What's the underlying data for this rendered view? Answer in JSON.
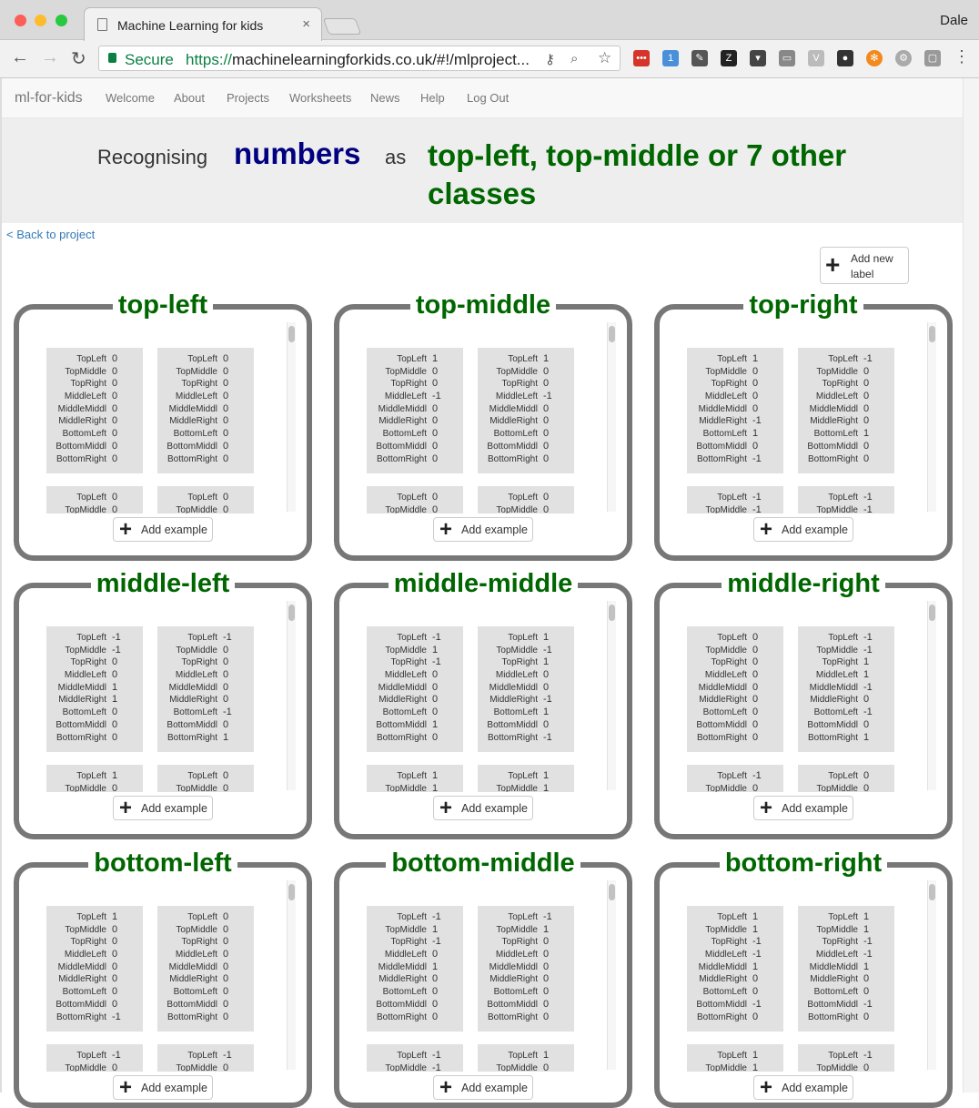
{
  "browser": {
    "tab_title": "Machine Learning for kids",
    "tab_close": "×",
    "user": "Dale",
    "secure_label": "Secure",
    "url_scheme": "https://",
    "url_rest": "machinelearningforkids.co.uk/#!/mlproject..."
  },
  "navbar": {
    "brand": "ml-for-kids",
    "links": [
      "Welcome",
      "About",
      "Projects",
      "Worksheets",
      "News",
      "Help",
      "Log Out"
    ]
  },
  "heading": {
    "prefix": "Recognising",
    "type": "numbers",
    "as": "as",
    "classes": "top-left, top-middle or 7 other classes"
  },
  "back_link": "< Back to project",
  "add_label_button": "Add new label",
  "add_example_button": "Add example",
  "field_names": [
    "TopLeft",
    "TopMiddle",
    "TopRight",
    "MiddleLeft",
    "MiddleMiddl",
    "MiddleRight",
    "BottomLeft",
    "BottomMiddl",
    "BottomRight"
  ],
  "labels": [
    {
      "name": "top-left",
      "examples": [
        [
          "0",
          "0",
          "0",
          "0",
          "0",
          "0",
          "0",
          "0",
          "0"
        ],
        [
          "0",
          "0",
          "0",
          "0",
          "0",
          "0",
          "0",
          "0",
          "0"
        ],
        [
          "0",
          "0"
        ],
        [
          "0",
          "0"
        ]
      ]
    },
    {
      "name": "top-middle",
      "examples": [
        [
          "1",
          "0",
          "0",
          "-1",
          "0",
          "0",
          "0",
          "0",
          "0"
        ],
        [
          "1",
          "0",
          "0",
          "-1",
          "0",
          "0",
          "0",
          "0",
          "0"
        ],
        [
          "0",
          "0"
        ],
        [
          "0",
          "0"
        ]
      ]
    },
    {
      "name": "top-right",
      "examples": [
        [
          "1",
          "0",
          "0",
          "0",
          "0",
          "-1",
          "1",
          "0",
          "-1"
        ],
        [
          "-1",
          "0",
          "0",
          "0",
          "0",
          "0",
          "1",
          "0",
          "0"
        ],
        [
          "-1",
          "-1"
        ],
        [
          "-1",
          "-1"
        ]
      ]
    },
    {
      "name": "middle-left",
      "examples": [
        [
          "-1",
          "-1",
          "0",
          "0",
          "1",
          "1",
          "0",
          "0",
          "0"
        ],
        [
          "-1",
          "0",
          "0",
          "0",
          "0",
          "0",
          "-1",
          "0",
          "1"
        ],
        [
          "1",
          "0"
        ],
        [
          "0",
          "0"
        ]
      ]
    },
    {
      "name": "middle-middle",
      "examples": [
        [
          "-1",
          "1",
          "-1",
          "0",
          "0",
          "0",
          "0",
          "1",
          "0"
        ],
        [
          "1",
          "-1",
          "1",
          "0",
          "0",
          "-1",
          "1",
          "0",
          "-1"
        ],
        [
          "1",
          "1"
        ],
        [
          "1",
          "1"
        ]
      ]
    },
    {
      "name": "middle-right",
      "examples": [
        [
          "0",
          "0",
          "0",
          "0",
          "0",
          "0",
          "0",
          "0",
          "0"
        ],
        [
          "-1",
          "-1",
          "1",
          "1",
          "-1",
          "0",
          "-1",
          "0",
          "1"
        ],
        [
          "-1",
          "0"
        ],
        [
          "0",
          "0"
        ]
      ]
    },
    {
      "name": "bottom-left",
      "examples": [
        [
          "1",
          "0",
          "0",
          "0",
          "0",
          "0",
          "0",
          "0",
          "-1"
        ],
        [
          "0",
          "0",
          "0",
          "0",
          "0",
          "0",
          "0",
          "0",
          "0"
        ],
        [
          "-1",
          "0"
        ],
        [
          "-1",
          "0"
        ]
      ]
    },
    {
      "name": "bottom-middle",
      "examples": [
        [
          "-1",
          "1",
          "-1",
          "0",
          "1",
          "0",
          "0",
          "0",
          "0"
        ],
        [
          "-1",
          "1",
          "0",
          "0",
          "0",
          "0",
          "0",
          "0",
          "0"
        ],
        [
          "-1",
          "-1"
        ],
        [
          "1",
          "0"
        ]
      ]
    },
    {
      "name": "bottom-right",
      "examples": [
        [
          "1",
          "1",
          "-1",
          "-1",
          "1",
          "0",
          "0",
          "-1",
          "0"
        ],
        [
          "1",
          "1",
          "-1",
          "-1",
          "1",
          "0",
          "0",
          "-1",
          "0"
        ],
        [
          "1",
          "1"
        ],
        [
          "-1",
          "0"
        ]
      ]
    }
  ]
}
